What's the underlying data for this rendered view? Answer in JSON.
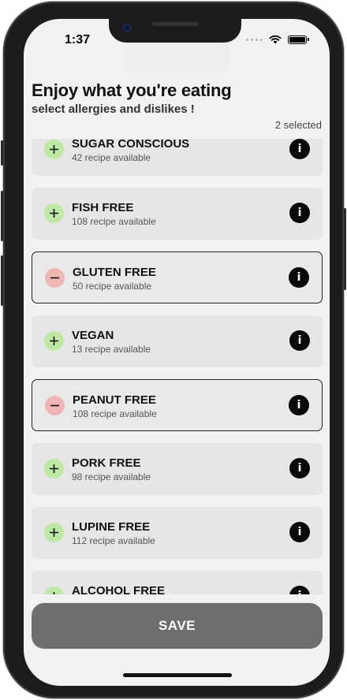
{
  "status_bar": {
    "time": "1:37"
  },
  "header": {
    "title": "Enjoy what you're eating",
    "subtitle": "select allergies and dislikes !",
    "selected_count": "2 selected"
  },
  "items": [
    {
      "name": "SUGAR CONSCIOUS",
      "sub": "42 recipe available",
      "selected": false
    },
    {
      "name": "FISH FREE",
      "sub": "108 recipe available",
      "selected": false
    },
    {
      "name": "GLUTEN FREE",
      "sub": "50 recipe available",
      "selected": true
    },
    {
      "name": "VEGAN",
      "sub": "13 recipe available",
      "selected": false
    },
    {
      "name": "PEANUT FREE",
      "sub": "108 recipe available",
      "selected": true
    },
    {
      "name": "PORK FREE",
      "sub": "98 recipe available",
      "selected": false
    },
    {
      "name": "LUPINE FREE",
      "sub": "112 recipe available",
      "selected": false
    },
    {
      "name": "ALCOHOL FREE",
      "sub": "",
      "selected": false
    }
  ],
  "info_label": "i",
  "save_button": {
    "label": "SAVE"
  },
  "colors": {
    "add_toggle": "#bfe8a4",
    "remove_toggle": "#f0b6b6",
    "save_button": "#6e6e6e",
    "screen_bg": "#f2f2f2"
  },
  "icons": {
    "add": "plus-icon",
    "remove": "minus-icon",
    "info": "info-icon"
  }
}
